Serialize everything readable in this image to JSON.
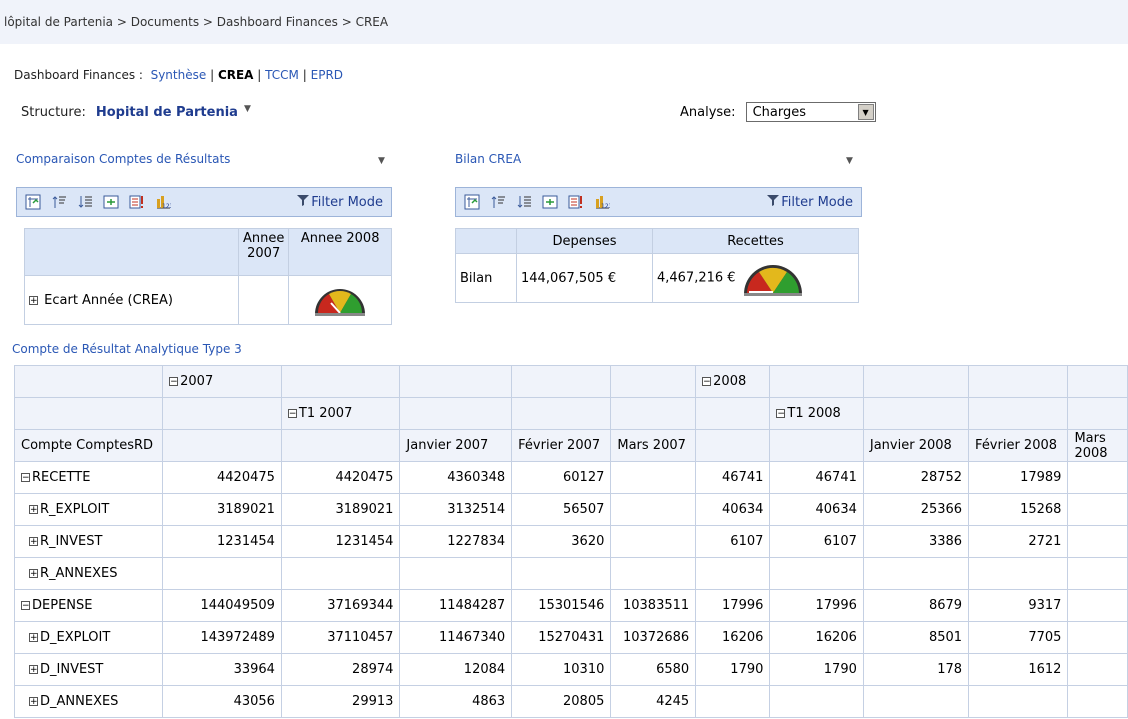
{
  "breadcrumb": "lôpital de Partenia > Documents > Dashboard Finances > CREA",
  "dashnav": {
    "label": "Dashboard Finances :",
    "links": [
      "Synthèse",
      "CREA",
      "TCCM",
      "EPRD"
    ],
    "sep": "|"
  },
  "structure": {
    "label": "Structure:",
    "value": "Hopital de Partenia"
  },
  "analyse": {
    "label": "Analyse:",
    "value": "Charges"
  },
  "wp1": {
    "title": "Comparaison Comptes de Résultats",
    "filter": "Filter Mode",
    "col1": "Annee 2007",
    "col2": "Annee 2008",
    "row": "Ecart Année (CREA)"
  },
  "wp2": {
    "title": "Bilan CREA",
    "filter": "Filter Mode",
    "col1": "Depenses",
    "col2": "Recettes",
    "row": "Bilan",
    "v1": "144,067,505 €",
    "v2": "4,467,216 €"
  },
  "crt": {
    "title": "Compte de Résultat Analytique Type 3",
    "year1": "2007",
    "t1_1": "T1 2007",
    "year2": "2008",
    "t1_2": "T1 2008",
    "col0": "Compte ComptesRD",
    "months": [
      "Janvier 2007",
      "Février 2007",
      "Mars 2007",
      "Janvier 2008",
      "Février 2008",
      "Mars 2008"
    ],
    "rows": [
      {
        "label": "RECETTE",
        "sym": "−",
        "indent": false,
        "v": [
          "4420475",
          "4420475",
          "4360348",
          "60127",
          "",
          "46741",
          "46741",
          "28752",
          "17989",
          ""
        ]
      },
      {
        "label": "R_EXPLOIT",
        "sym": "+",
        "indent": true,
        "v": [
          "3189021",
          "3189021",
          "3132514",
          "56507",
          "",
          "40634",
          "40634",
          "25366",
          "15268",
          ""
        ]
      },
      {
        "label": "R_INVEST",
        "sym": "+",
        "indent": true,
        "v": [
          "1231454",
          "1231454",
          "1227834",
          "3620",
          "",
          "6107",
          "6107",
          "3386",
          "2721",
          ""
        ]
      },
      {
        "label": "R_ANNEXES",
        "sym": "+",
        "indent": true,
        "v": [
          "",
          "",
          "",
          "",
          "",
          "",
          "",
          "",
          "",
          ""
        ]
      },
      {
        "label": "DEPENSE",
        "sym": "−",
        "indent": false,
        "v": [
          "144049509",
          "37169344",
          "11484287",
          "15301546",
          "10383511",
          "17996",
          "17996",
          "8679",
          "9317",
          ""
        ]
      },
      {
        "label": "D_EXPLOIT",
        "sym": "+",
        "indent": true,
        "v": [
          "143972489",
          "37110457",
          "11467340",
          "15270431",
          "10372686",
          "16206",
          "16206",
          "8501",
          "7705",
          ""
        ]
      },
      {
        "label": "D_INVEST",
        "sym": "+",
        "indent": true,
        "v": [
          "33964",
          "28974",
          "12084",
          "10310",
          "6580",
          "1790",
          "1790",
          "178",
          "1612",
          ""
        ]
      },
      {
        "label": "D_ANNEXES",
        "sym": "+",
        "indent": true,
        "v": [
          "43056",
          "29913",
          "4863",
          "20805",
          "4245",
          "",
          "",
          "",
          "",
          ""
        ]
      }
    ]
  }
}
